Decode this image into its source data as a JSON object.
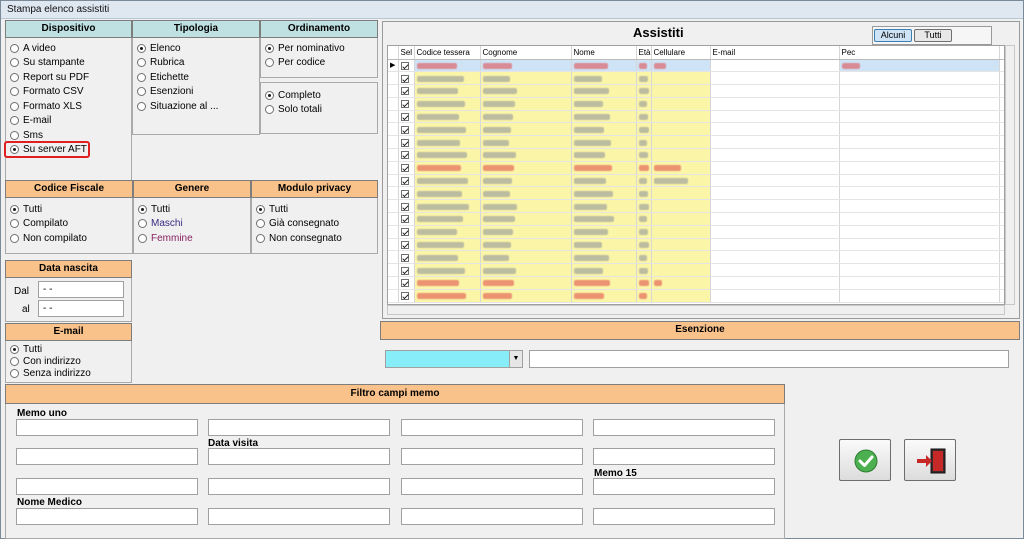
{
  "window": {
    "title": "Stampa elenco assistiti"
  },
  "dispositivo": {
    "header": "Dispositivo",
    "options": [
      "A video",
      "Su stampante",
      "Report su PDF",
      "Formato CSV",
      "Formato XLS",
      "E-mail",
      "Sms",
      "Su server AFT"
    ],
    "selected": 7
  },
  "tipologia": {
    "header": "Tipologia",
    "options": [
      "Elenco",
      "Rubrica",
      "Etichette",
      "Esenzioni",
      "Situazione al ..."
    ],
    "selected": 0
  },
  "ordinamento": {
    "header": "Ordinamento",
    "options": [
      "Per nominativo",
      "Per codice"
    ],
    "selected": 0,
    "options2": [
      "Completo",
      "Solo totali"
    ],
    "selected2": 0
  },
  "codice_fiscale": {
    "header": "Codice Fiscale",
    "options": [
      "Tutti",
      "Compilato",
      "Non compilato"
    ],
    "selected": 0
  },
  "genere": {
    "header": "Genere",
    "options": [
      "Tutti",
      "Maschi",
      "Femmine"
    ],
    "selected": 0
  },
  "modulo_privacy": {
    "header": "Modulo privacy",
    "options": [
      "Tutti",
      "Già consegnato",
      "Non consegnato"
    ],
    "selected": 0
  },
  "data_nascita": {
    "header": "Data nascita",
    "dal_label": "Dal",
    "al_label": "al",
    "dal_value": " -  -",
    "al_value": " -  -"
  },
  "email": {
    "header": "E-mail",
    "options": [
      "Tutti",
      "Con indirizzo",
      "Senza indirizzo"
    ],
    "selected": 0
  },
  "assistiti": {
    "title": "Assistiti",
    "toggle_buttons": [
      "Alcuni",
      "Tutti"
    ],
    "columns": [
      "Sel",
      "Codice tessera",
      "Cognome",
      "Nome",
      "Età",
      "Cellulare",
      "E-mail",
      "Pec"
    ],
    "row_count": 19,
    "red_rows": [
      0,
      8,
      17,
      18
    ]
  },
  "esenzione": {
    "header": "Esenzione",
    "combo_value": "",
    "text_value": ""
  },
  "memo": {
    "header": "Filtro campi memo",
    "labels": {
      "memo_uno": "Memo uno",
      "data_visita": "Data visita",
      "memo_15": "Memo 15",
      "nome_medico": "Nome Medico"
    }
  },
  "colors": {
    "header_orange": "#f9c28b",
    "header_teal": "#bfe1e2",
    "grid_yellow": "#fbf5a8",
    "selection_blue": "#cfe3f7",
    "redbox": "#e02020",
    "combo_cyan": "#87eef9"
  },
  "actions": {
    "confirm_icon": "check-icon",
    "exit_icon": "exit-door-icon"
  }
}
